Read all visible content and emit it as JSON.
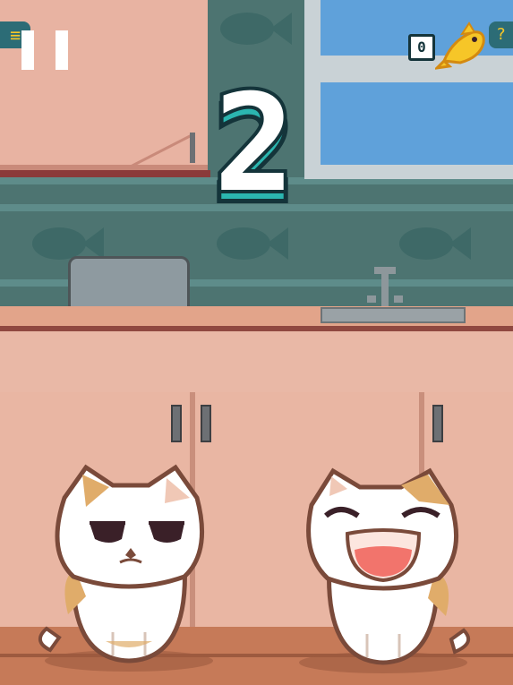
{
  "hud": {
    "menu_icon_glyph": "≡",
    "fish_count": "0",
    "help_label": "?"
  },
  "score": {
    "value": "2"
  },
  "colors": {
    "hud_accent": "#f6c628",
    "hud_panel": "#2c6c76",
    "score_outline": "#14343a",
    "score_fill": "#ffffff",
    "score_shade": "#2bb6b0",
    "wall": "#4d7471",
    "cabinet": "#e9b6a3",
    "cat_patch": "#e0ac6a"
  },
  "icons": {
    "menu": "hamburger-icon",
    "pause": "pause-icon",
    "fish": "golden-fish-icon",
    "help": "question-mark-icon"
  }
}
